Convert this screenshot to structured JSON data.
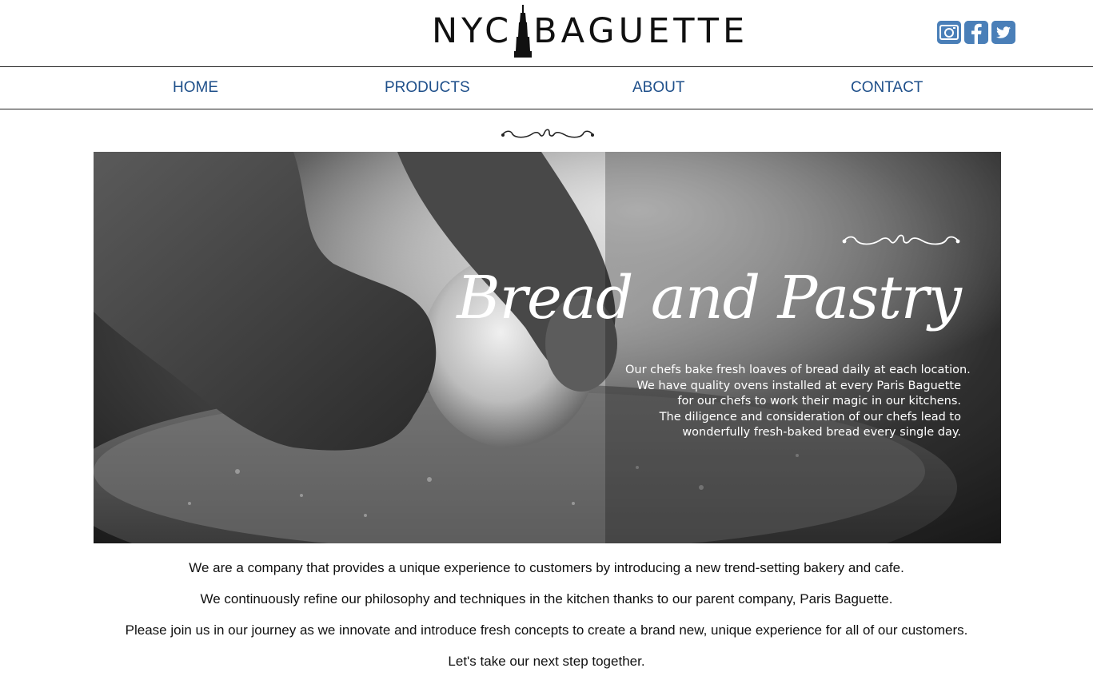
{
  "header": {
    "logo_left": "NYC",
    "logo_right": "BAGUETTE",
    "social_icons": [
      "instagram-icon",
      "facebook-icon",
      "twitter-icon"
    ],
    "accent_color": "#4a7fb8"
  },
  "nav": {
    "items": [
      {
        "label": "HOME"
      },
      {
        "label": "PRODUCTS"
      },
      {
        "label": "ABOUT"
      },
      {
        "label": "CONTACT"
      }
    ],
    "color": "#1e4f8a"
  },
  "hero": {
    "title": "Bread and Pastry",
    "lines": [
      "Our chefs bake fresh loaves of bread daily at each location.",
      "We have quality ovens installed at every Paris Baguette",
      "for our chefs to work their magic in our kitchens.",
      "The diligence and consideration of our chefs lead to",
      "wonderfully fresh-baked bread every single day."
    ]
  },
  "intro": {
    "paragraphs": [
      "We are a company that provides a unique experience to customers by introducing a new trend-setting bakery and cafe.",
      "We continuously refine our philosophy and techniques in the kitchen thanks to our parent company, Paris Baguette.",
      "Please join us in our journey as we innovate and introduce fresh concepts to create a brand new, unique experience for all of our customers.",
      "Let's take our next step together."
    ]
  }
}
